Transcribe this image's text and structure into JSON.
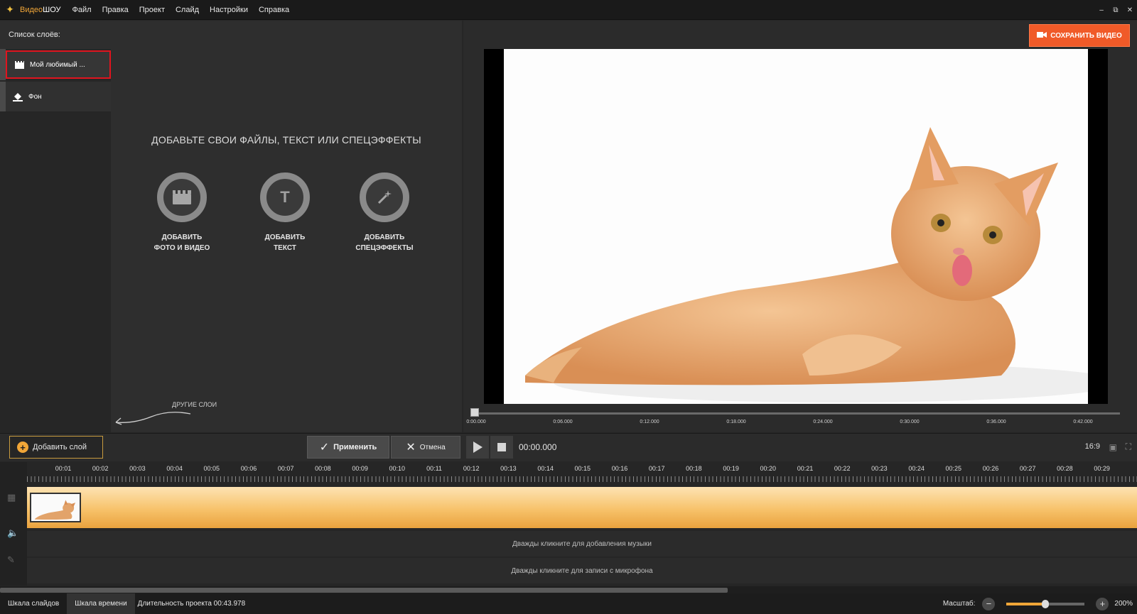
{
  "menubar": {
    "app_name_part1": "Видео",
    "app_name_part2": "ШОУ",
    "items": [
      "Файл",
      "Правка",
      "Проект",
      "Слайд",
      "Настройки",
      "Справка"
    ],
    "window_controls": [
      "‒",
      "⧉",
      "✕"
    ]
  },
  "layers": {
    "title": "Список слоёв:",
    "items": [
      {
        "label": "Мой любимый ...",
        "icon": "film-icon",
        "selected": true
      },
      {
        "label": "Фон",
        "icon": "paint-bucket-icon",
        "selected": false
      }
    ],
    "other_layers_hint": "ДРУГИЕ СЛОИ"
  },
  "drop_area": {
    "title": "ДОБАВЬТЕ СВОИ ФАЙЛЫ, ТЕКСТ ИЛИ СПЕЦЭФФЕКТЫ",
    "buttons": [
      {
        "line1": "ДОБАВИТЬ",
        "line2": "ФОТО И ВИДЕО",
        "icon": "clapperboard-icon"
      },
      {
        "line1": "ДОБАВИТЬ",
        "line2": "ТЕКСТ",
        "icon": "text-icon",
        "glyph": "T"
      },
      {
        "line1": "ДОБАВИТЬ",
        "line2": "СПЕЦЭФФЕКТЫ",
        "icon": "magic-wand-icon"
      }
    ]
  },
  "preview": {
    "save_label": "СОХРАНИТЬ ВИДЕО",
    "scrub_ticks": [
      "0:00.000",
      "0:06.000",
      "0:12.000",
      "0:18.000",
      "0:24.000",
      "0:30.000",
      "0:36.000",
      "0:42.000"
    ]
  },
  "toolbar": {
    "add_layer": "Добавить слой",
    "apply": "Применить",
    "cancel": "Отмена",
    "time": "00:00.000",
    "ratio": "16:9"
  },
  "timeline": {
    "ruler_labels": [
      "00:01",
      "00:02",
      "00:03",
      "00:04",
      "00:05",
      "00:06",
      "00:07",
      "00:08",
      "00:09",
      "00:10",
      "00:11",
      "00:12",
      "00:13",
      "00:14",
      "00:15",
      "00:16",
      "00:17",
      "00:18",
      "00:19",
      "00:20",
      "00:21",
      "00:22",
      "00:23",
      "00:24",
      "00:25",
      "00:26",
      "00:27",
      "00:28",
      "00:29"
    ],
    "music_hint": "Дважды кликните для добавления музыки",
    "mic_hint": "Дважды кликните для записи с микрофона"
  },
  "statusbar": {
    "tab_slides": "Шкала слайдов",
    "tab_time": "Шкала времени",
    "duration": "Длительность проекта 00:43.978",
    "zoom_label": "Масштаб:",
    "zoom_value": "200%",
    "zoom_level": 0.5
  },
  "colors": {
    "accent": "#f1a638",
    "save": "#f05a28",
    "selection_border": "#e0141e"
  }
}
